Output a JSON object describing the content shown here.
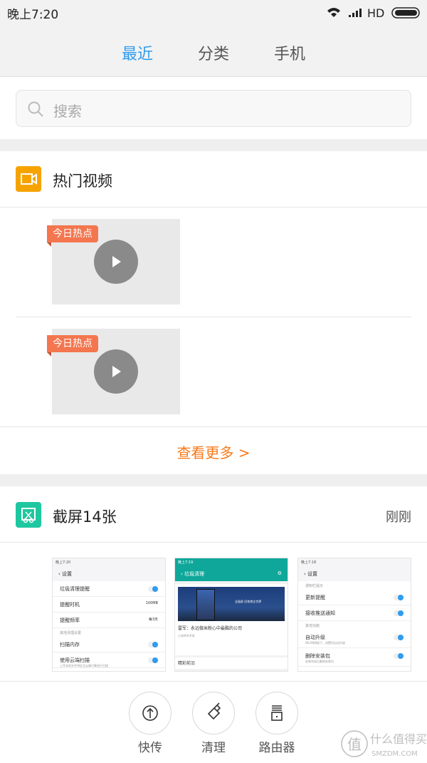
{
  "status_bar": {
    "time": "晚上7:20",
    "network": "HD"
  },
  "tabs": [
    {
      "label": "最近",
      "active": true
    },
    {
      "label": "分类",
      "active": false
    },
    {
      "label": "手机",
      "active": false
    }
  ],
  "search": {
    "placeholder": "搜索"
  },
  "hot_videos": {
    "title": "热门视频",
    "icon": "video-icon",
    "icon_color": "#f6a300",
    "items": [
      {
        "badge": "今日热点"
      },
      {
        "badge": "今日热点"
      }
    ],
    "more": "查看更多 >",
    "more_color": "#f77a1c"
  },
  "screenshots": {
    "title": "截屏14张",
    "time": "刚刚",
    "icon": "screenshot-icon",
    "icon_color": "#1fc7a0",
    "thumbs": [
      {
        "time": "晚上7:20",
        "header": "设置",
        "rows": [
          "垃圾清理提醒",
          "提醒时机",
          "提醒频率"
        ],
        "row2_value": "100MB",
        "row3_value": "每3天",
        "section": "其他清理设置",
        "rows2": [
          "扫描内存",
          "使用云端扫描"
        ],
        "rows2_sub": "上传未知文件特征至云端引擎进行扫描"
      },
      {
        "time": "晚上7:19",
        "header": "垃圾清理",
        "banner_text": "全面屏 仍惊艳全世界",
        "article": "雷军：永远做米粉心中最酷的公司",
        "source": "小米MIX评测",
        "next": "精彩前沿"
      },
      {
        "time": "晚上7:18",
        "section1": "通知栏提示",
        "header": "设置",
        "rows": [
          "更新提醒",
          "接收推送通知"
        ],
        "section2": "其他功能",
        "rows2": [
          "自动升级",
          "删除安装包"
        ],
        "rows2_sub": [
          "WLAN网络下，闲置时自动升级",
          "安装完成后删除安装包"
        ]
      }
    ]
  },
  "bottom_actions": [
    {
      "label": "快传",
      "icon": "upload-icon"
    },
    {
      "label": "清理",
      "icon": "brush-icon"
    },
    {
      "label": "路由器",
      "icon": "router-icon"
    }
  ],
  "watermark": {
    "text": "什么值得买",
    "sub": "SMZDM.COM"
  }
}
